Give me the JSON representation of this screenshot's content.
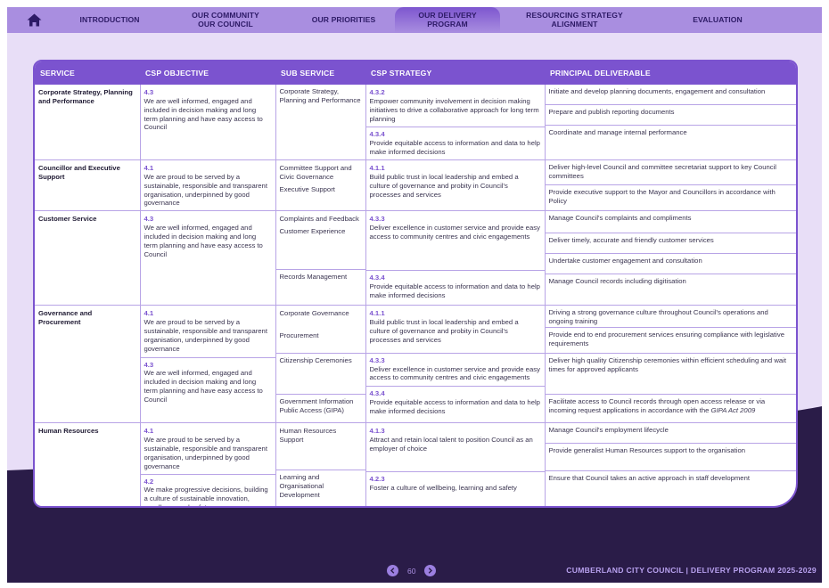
{
  "nav": {
    "items": [
      {
        "label": "INTRODUCTION"
      },
      {
        "label": "OUR COMMUNITY\nOUR COUNCIL"
      },
      {
        "label": "OUR PRIORITIES"
      },
      {
        "label": "OUR DELIVERY\nPROGRAM"
      },
      {
        "label": "RESOURCING STRATEGY\nALIGNMENT"
      },
      {
        "label": "EVALUATION"
      }
    ],
    "active_index": 3
  },
  "table": {
    "headers": [
      "SERVICE",
      "CSP OBJECTIVE",
      "SUB SERVICE",
      "CSP STRATEGY",
      "PRINCIPAL DELIVERABLE"
    ],
    "corporate": {
      "service": "Corporate Strategy, Planning and Performance",
      "obj_num": "4.3",
      "obj_text": "We are well informed, engaged and included in decision making and long term planning and have easy access to Council",
      "sub": "Corporate Strategy, Planning and Performance",
      "s1_num": "4.3.2",
      "s1_text": "Empower community involvement in decision making initiatives to drive a collaborative approach for long term planning",
      "s2_num": "4.3.4",
      "s2_text": "Provide equitable access to information and data to help make informed decisions",
      "d1": "Initiate and develop planning documents, engagement and consultation",
      "d2": "Prepare and publish reporting documents",
      "d3": "Coordinate and manage internal performance"
    },
    "councillor": {
      "service": "Councillor and Executive Support",
      "obj_num": "4.1",
      "obj_text": "We are proud to be served by a sustainable, responsible and transparent organisation, underpinned by good governance",
      "sub1": "Committee Support and Civic Governance",
      "sub2": "Executive Support",
      "s_num": "4.1.1",
      "s_text": "Build public trust in local leadership and embed a culture of governance and probity in Council's processes and services",
      "d1": "Deliver high-level Council and committee secretariat support to key Council committees",
      "d2": "Provide executive support to the Mayor and Councillors in accordance with Policy"
    },
    "customer": {
      "service": "Customer Service",
      "obj_num": "4.3",
      "obj_text": "We are well informed, engaged and included in decision making and long term planning and have easy access to Council",
      "sub1": "Complaints and Feedback",
      "sub2": "Customer Experience",
      "sub3": "Records Management",
      "s1_num": "4.3.3",
      "s1_text": "Deliver excellence in customer service and provide easy access to community centres and civic engagements",
      "s2_num": "4.3.4",
      "s2_text": "Provide equitable access to information and data to help make informed decisions",
      "d1": "Manage Council's complaints and compliments",
      "d2": "Deliver timely, accurate and friendly customer services",
      "d3": "Undertake customer engagement and consultation",
      "d4": "Manage Council records including digitisation"
    },
    "governance": {
      "service": "Governance and Procurement",
      "obj1_num": "4.1",
      "obj1_text": "We are proud to be served by a sustainable, responsible and transparent organisation, underpinned by good governance",
      "obj2_num": "4.3",
      "obj2_text": "We are well informed, engaged and included in decision making and long term planning and have easy access to Council",
      "sub1": "Corporate Governance",
      "sub2": "Procurement",
      "sub3": "Citizenship Ceremonies",
      "sub4": "Government Information Public Access (GIPA)",
      "s1_num": "4.1.1",
      "s1_text": "Build public trust in local leadership and embed a culture of governance and probity in Council's processes and services",
      "s2_num": "4.3.3",
      "s2_text": "Deliver excellence in customer service and provide easy access to community centres and civic engagements",
      "s3_num": "4.3.4",
      "s3_text": "Provide equitable access to information and data to help make informed decisions",
      "d1": "Driving a strong governance culture throughout Council's operations and ongoing training",
      "d2": "Provide end to end procurement services ensuring compliance with legislative requirements",
      "d3": "Deliver high quality Citizenship ceremonies within efficient scheduling and wait times for approved applicants",
      "d4a": "Facilitate access to Council records through open access release or via incoming request applications in accordance with the ",
      "d4b": "GIPA Act 2009"
    },
    "hr": {
      "service": "Human Resources",
      "obj1_num": "4.1",
      "obj1_text": "We are proud to be served by a sustainable, responsible and transparent organisation, underpinned by good governance",
      "obj2_num": "4.2",
      "obj2_text": "We make progressive decisions, building a culture of sustainable innovation, excellence and safety",
      "sub1": "Human Resources Support",
      "sub2": "Learning and Organisational Development",
      "s1_num": "4.1.3",
      "s1_text": "Attract and retain local talent to position Council as an employer of choice",
      "s2_num": "4.2.3",
      "s2_text": "Foster a culture of wellbeing, learning and safety",
      "d1": "Manage Council's employment lifecycle",
      "d2": "Provide generalist Human Resources support to the organisation",
      "d3": "Ensure that Council takes an active approach in staff development"
    }
  },
  "footer": {
    "page_number": "60",
    "title": "CUMBERLAND CITY COUNCIL | DELIVERY PROGRAM 2025-2029"
  },
  "colors": {
    "accent": "#7b53cf",
    "nav_bg": "#a98ee0",
    "page_bg": "#e8def7",
    "dark_wave": "#2a1c48"
  }
}
